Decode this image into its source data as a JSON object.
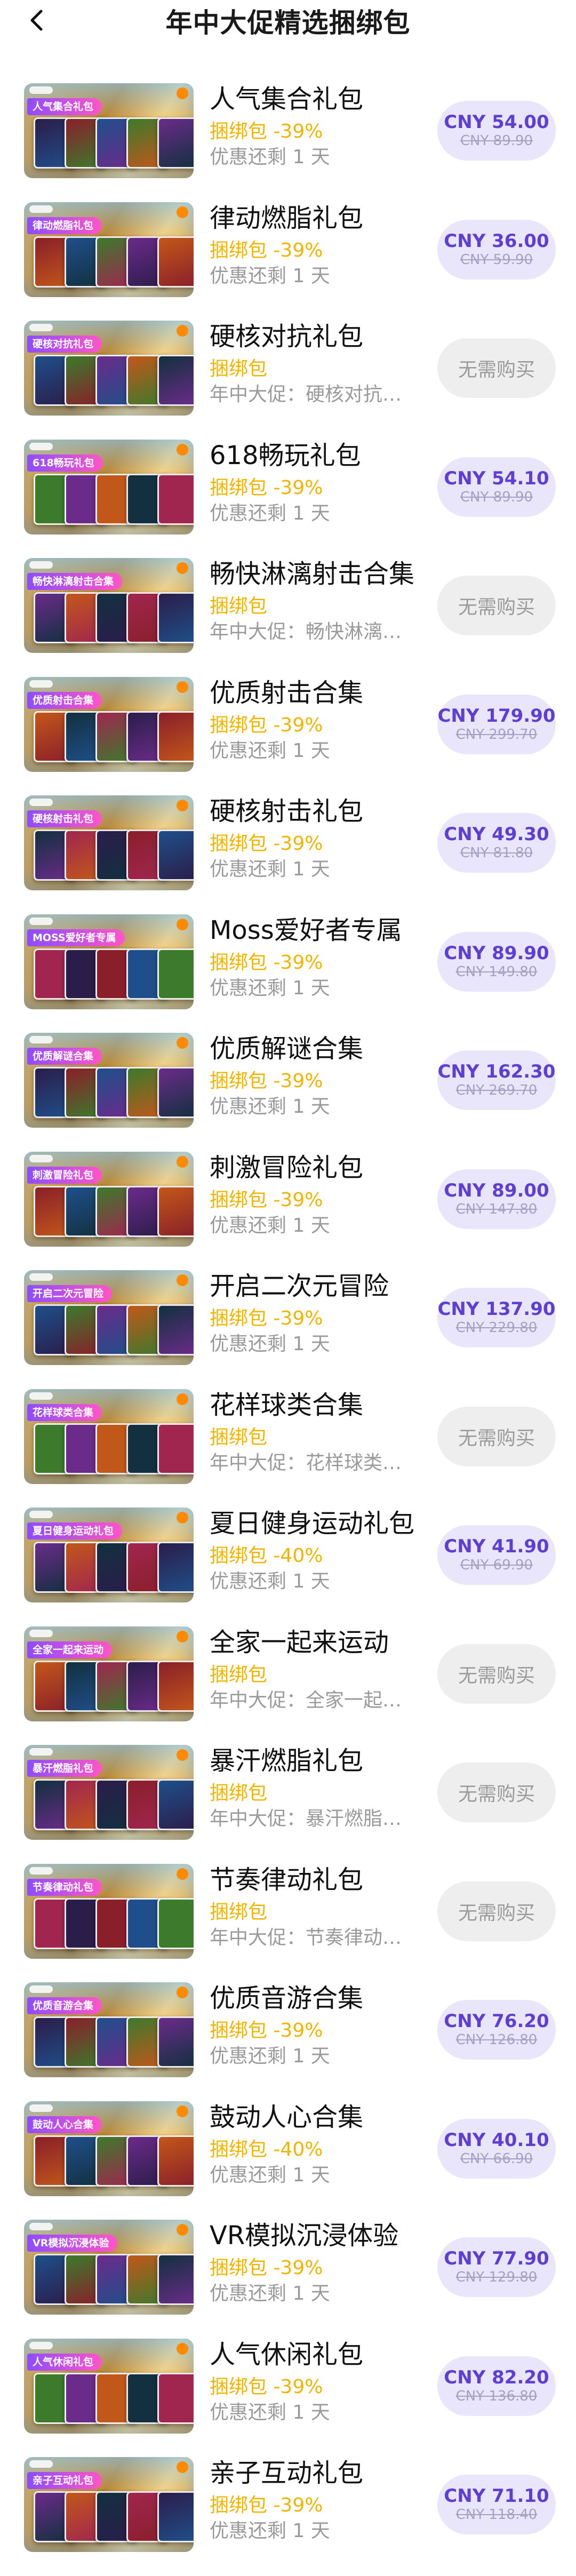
{
  "header": {
    "title": "年中大促精选捆绑包",
    "back_icon": "chevron-left-icon"
  },
  "items": [
    {
      "name": "人气集合礼包",
      "tag": "人气集合礼包",
      "label": "捆绑包 -39%",
      "note": "优惠还剩 1 天",
      "price": "CNY 54.00",
      "original": "CNY 89.90",
      "purchasable": true
    },
    {
      "name": "律动燃脂礼包",
      "tag": "律动燃脂礼包",
      "label": "捆绑包 -39%",
      "note": "优惠还剩 1 天",
      "price": "CNY 36.00",
      "original": "CNY 59.90",
      "purchasable": true
    },
    {
      "name": "硬核对抗礼包",
      "tag": "硬核对抗礼包",
      "label": "捆绑包",
      "note": "年中大促：硬核对抗礼包",
      "button": "无需购买",
      "purchasable": false
    },
    {
      "name": "618畅玩礼包",
      "tag": "618畅玩礼包",
      "label": "捆绑包 -39%",
      "note": "优惠还剩 1 天",
      "price": "CNY 54.10",
      "original": "CNY 89.90",
      "purchasable": true
    },
    {
      "name": "畅快淋漓射击合集",
      "tag": "畅快淋漓射击合集",
      "label": "捆绑包",
      "note": "年中大促：畅快淋漓射击合集",
      "button": "无需购买",
      "purchasable": false
    },
    {
      "name": "优质射击合集",
      "tag": "优质射击合集",
      "label": "捆绑包 -39%",
      "note": "优惠还剩 1 天",
      "price": "CNY 179.90",
      "original": "CNY 299.70",
      "purchasable": true
    },
    {
      "name": "硬核射击礼包",
      "tag": "硬核射击礼包",
      "label": "捆绑包 -39%",
      "note": "优惠还剩 1 天",
      "price": "CNY 49.30",
      "original": "CNY 81.80",
      "purchasable": true
    },
    {
      "name": "Moss爱好者专属",
      "tag": "MOSS爱好者专属",
      "label": "捆绑包 -39%",
      "note": "优惠还剩 1 天",
      "price": "CNY 89.90",
      "original": "CNY 149.80",
      "purchasable": true
    },
    {
      "name": "优质解谜合集",
      "tag": "优质解谜合集",
      "label": "捆绑包 -39%",
      "note": "优惠还剩 1 天",
      "price": "CNY 162.30",
      "original": "CNY 269.70",
      "purchasable": true
    },
    {
      "name": "刺激冒险礼包",
      "tag": "刺激冒险礼包",
      "label": "捆绑包 -39%",
      "note": "优惠还剩 1 天",
      "price": "CNY 89.00",
      "original": "CNY 147.80",
      "purchasable": true
    },
    {
      "name": "开启二次元冒险",
      "tag": "开启二次元冒险",
      "label": "捆绑包 -39%",
      "note": "优惠还剩 1 天",
      "price": "CNY 137.90",
      "original": "CNY 229.80",
      "purchasable": true
    },
    {
      "name": "花样球类合集",
      "tag": "花样球类合集",
      "label": "捆绑包",
      "note": "年中大促：花样球类合集",
      "button": "无需购买",
      "purchasable": false
    },
    {
      "name": "夏日健身运动礼包",
      "tag": "夏日健身运动礼包",
      "label": "捆绑包 -40%",
      "note": "优惠还剩 1 天",
      "price": "CNY 41.90",
      "original": "CNY 69.90",
      "purchasable": true
    },
    {
      "name": "全家一起来运动",
      "tag": "全家一起来运动",
      "label": "捆绑包",
      "note": "年中大促：全家一起来运动",
      "button": "无需购买",
      "purchasable": false
    },
    {
      "name": "暴汗燃脂礼包",
      "tag": "暴汗燃脂礼包",
      "label": "捆绑包",
      "note": "年中大促：暴汗燃脂礼包",
      "button": "无需购买",
      "purchasable": false
    },
    {
      "name": "节奏律动礼包",
      "tag": "节奏律动礼包",
      "label": "捆绑包",
      "note": "年中大促：节奏律动礼包",
      "button": "无需购买",
      "purchasable": false
    },
    {
      "name": "优质音游合集",
      "tag": "优质音游合集",
      "label": "捆绑包 -39%",
      "note": "优惠还剩 1 天",
      "price": "CNY 76.20",
      "original": "CNY 126.80",
      "purchasable": true
    },
    {
      "name": "鼓动人心合集",
      "tag": "鼓动人心合集",
      "label": "捆绑包 -40%",
      "note": "优惠还剩 1 天",
      "price": "CNY 40.10",
      "original": "CNY 66.90",
      "purchasable": true
    },
    {
      "name": "VR模拟沉浸体验",
      "tag": "VR模拟沉浸体验",
      "label": "捆绑包 -39%",
      "note": "优惠还剩 1 天",
      "price": "CNY 77.90",
      "original": "CNY 129.80",
      "purchasable": true
    },
    {
      "name": "人气休闲礼包",
      "tag": "人气休闲礼包",
      "label": "捆绑包 -39%",
      "note": "优惠还剩 1 天",
      "price": "CNY 82.20",
      "original": "CNY 136.80",
      "purchasable": true
    },
    {
      "name": "亲子互动礼包",
      "tag": "亲子互动礼包",
      "label": "捆绑包 -39%",
      "note": "优惠还剩 1 天",
      "price": "CNY 71.10",
      "original": "CNY 118.40",
      "purchasable": true
    }
  ],
  "cover_palette": [
    "#2b1d4a",
    "#8a1f2a",
    "#1f4f8a",
    "#3c7a2c",
    "#6b2b8a",
    "#c2571a",
    "#12303f",
    "#a0264f"
  ]
}
